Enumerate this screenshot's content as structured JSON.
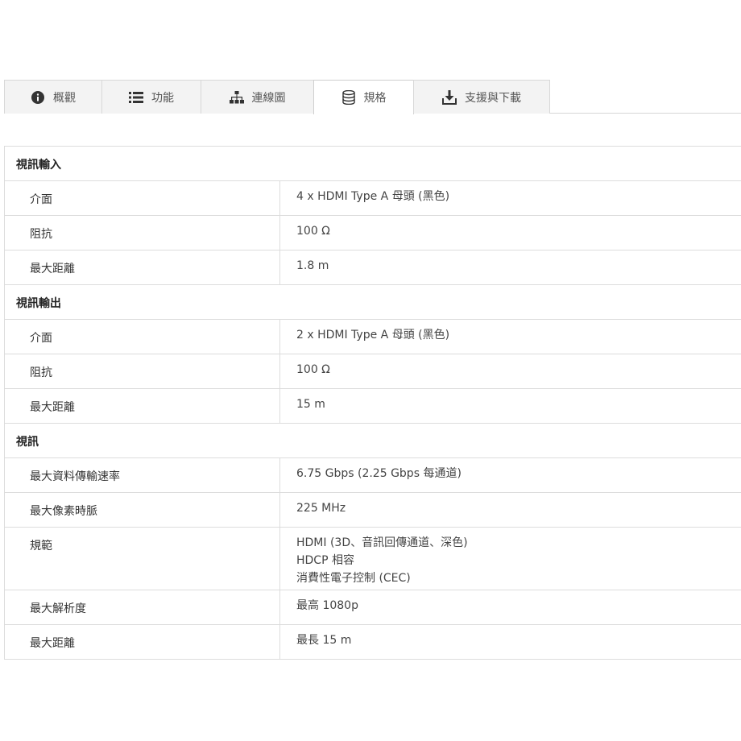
{
  "tabs": [
    {
      "label": "概觀",
      "icon": "info-icon"
    },
    {
      "label": "功能",
      "icon": "list-icon"
    },
    {
      "label": "連線圖",
      "icon": "sitemap-icon"
    },
    {
      "label": "規格",
      "icon": "database-icon",
      "active": true
    },
    {
      "label": "支援與下載",
      "icon": "download-icon"
    }
  ],
  "sections": [
    {
      "title": "視訊輸入",
      "rows": [
        {
          "label": "介面",
          "values": [
            "4 x HDMI Type A 母頭 (黑色)"
          ]
        },
        {
          "label": "阻抗",
          "values": [
            "100 Ω"
          ]
        },
        {
          "label": "最大距離",
          "values": [
            "1.8 m"
          ]
        }
      ]
    },
    {
      "title": "視訊輸出",
      "rows": [
        {
          "label": "介面",
          "values": [
            "2 x HDMI Type A 母頭 (黑色)"
          ]
        },
        {
          "label": "阻抗",
          "values": [
            "100 Ω"
          ]
        },
        {
          "label": "最大距離",
          "values": [
            "15 m"
          ]
        }
      ]
    },
    {
      "title": "視訊",
      "rows": [
        {
          "label": "最大資料傳輸速率",
          "values": [
            "6.75 Gbps (2.25 Gbps 每通道)"
          ]
        },
        {
          "label": "最大像素時脈",
          "values": [
            "225 MHz"
          ]
        },
        {
          "label": "規範",
          "values": [
            "HDMI (3D、音訊回傳通道、深色)",
            "HDCP 相容",
            "消費性電子控制 (CEC)"
          ]
        },
        {
          "label": "最大解析度",
          "values": [
            "最高 1080p"
          ]
        },
        {
          "label": "最大距離",
          "values": [
            "最長 15 m"
          ]
        }
      ]
    }
  ]
}
